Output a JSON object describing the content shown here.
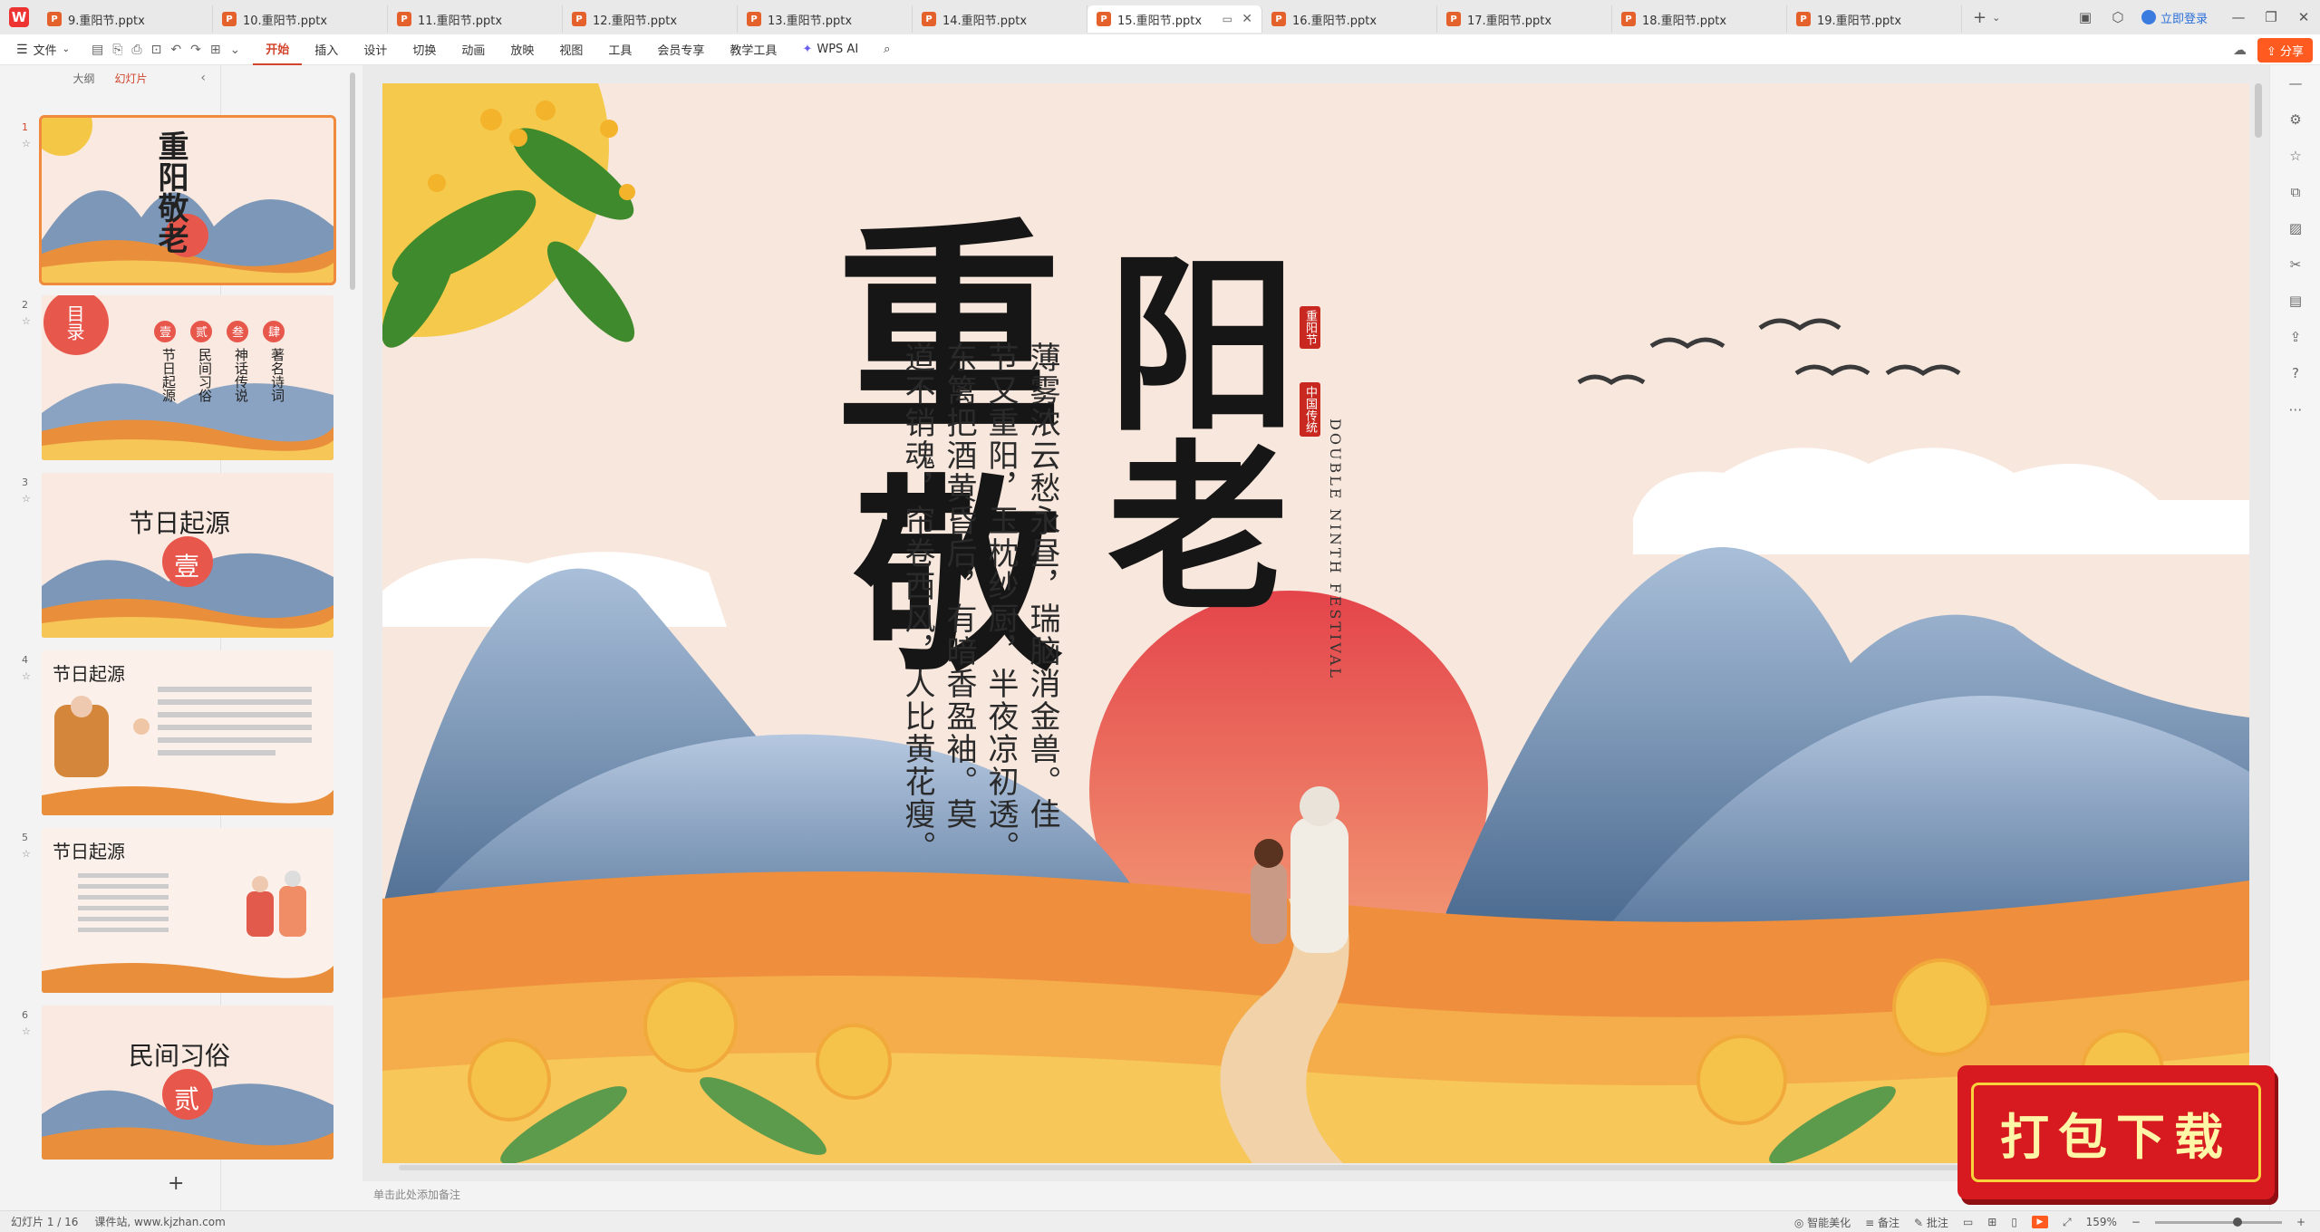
{
  "tabs": [
    {
      "label": "9.重阳节.pptx",
      "active": false
    },
    {
      "label": "10.重阳节.pptx",
      "active": false
    },
    {
      "label": "11.重阳节.pptx",
      "active": false
    },
    {
      "label": "12.重阳节.pptx",
      "active": false
    },
    {
      "label": "13.重阳节.pptx",
      "active": false
    },
    {
      "label": "14.重阳节.pptx",
      "active": false
    },
    {
      "label": "15.重阳节.pptx",
      "active": true
    },
    {
      "label": "16.重阳节.pptx",
      "active": false
    },
    {
      "label": "17.重阳节.pptx",
      "active": false
    },
    {
      "label": "18.重阳节.pptx",
      "active": false
    },
    {
      "label": "19.重阳节.pptx",
      "active": false
    }
  ],
  "tabbar": {
    "add": "+",
    "login": "立即登录"
  },
  "ribbon": {
    "file": "文件",
    "tabs": [
      "开始",
      "插入",
      "设计",
      "切换",
      "动画",
      "放映",
      "视图",
      "工具",
      "会员专享",
      "教学工具"
    ],
    "active_tab": "开始",
    "wps_ai": "WPS AI",
    "share": "分享"
  },
  "left_pane": {
    "tab_outline": "大纲",
    "tab_slides": "幻灯片",
    "slides": [
      {
        "num": "1",
        "title": "重阳敬老",
        "selected": true
      },
      {
        "num": "2",
        "title": "目录",
        "items": [
          "壹",
          "贰",
          "叁",
          "肆"
        ],
        "subs": [
          "节日起源",
          "民间习俗",
          "神话传说",
          "著名诗词"
        ]
      },
      {
        "num": "3",
        "title": "节日起源",
        "badge": "壹"
      },
      {
        "num": "4",
        "title": "节日起源"
      },
      {
        "num": "5",
        "title": "节日起源"
      },
      {
        "num": "6",
        "title": "民间习俗",
        "badge": "贰"
      }
    ],
    "add_slide": "+"
  },
  "slide": {
    "title_chars": [
      "重",
      "阳",
      "敬",
      "老"
    ],
    "seal_top": "重阳节",
    "seal_mid": "中国传统",
    "english": "DOUBLE NINTH FESTIVAL",
    "poem_columns": [
      "薄雾浓云愁永昼，瑞脑消金兽。佳",
      "节又重阳，玉枕纱厨，半夜凉初透。",
      "东篱把酒黄昏后，有暗香盈袖。莫",
      "道不销魂，帘卷西风，人比黄花瘦。"
    ]
  },
  "notes_placeholder": "单击此处添加备注",
  "statusbar": {
    "slide_info": "幻灯片 1 / 16",
    "source": "课件站, www.kjzhan.com",
    "beautify": "智能美化",
    "notes": "备注",
    "comment": "批注",
    "zoom": "159%"
  },
  "promo": {
    "label": "打包下载"
  },
  "colors": {
    "accent": "#d2452c",
    "sun": "#e8574c",
    "mountain_blue": "#4b6f95",
    "field_orange": "#f0a24a"
  }
}
